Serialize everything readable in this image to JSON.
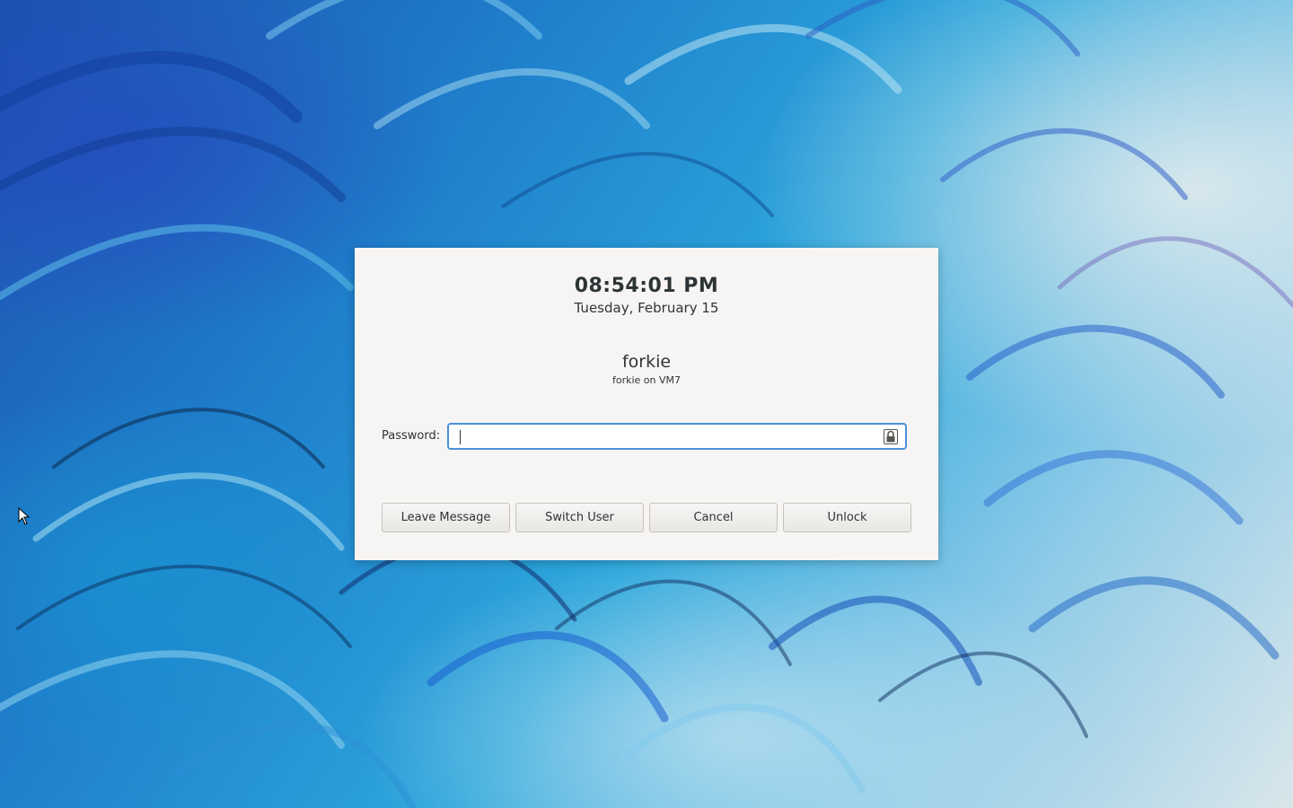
{
  "lock_screen": {
    "time": "08:54:01 PM",
    "date": "Tuesday, February 15",
    "user_name": "forkie",
    "host_line": "forkie on VM7",
    "password_label": "Password:",
    "password_value": ""
  },
  "buttons": {
    "leave_message": "Leave Message",
    "switch_user": "Switch User",
    "cancel": "Cancel",
    "unlock": "Unlock"
  },
  "icons": {
    "password_field": "lock-icon",
    "pointer": "mouse-pointer-icon"
  },
  "colors": {
    "focus_border": "#4a90d9",
    "dialog_background": "#f6f5f4",
    "text": "#2e3436"
  }
}
